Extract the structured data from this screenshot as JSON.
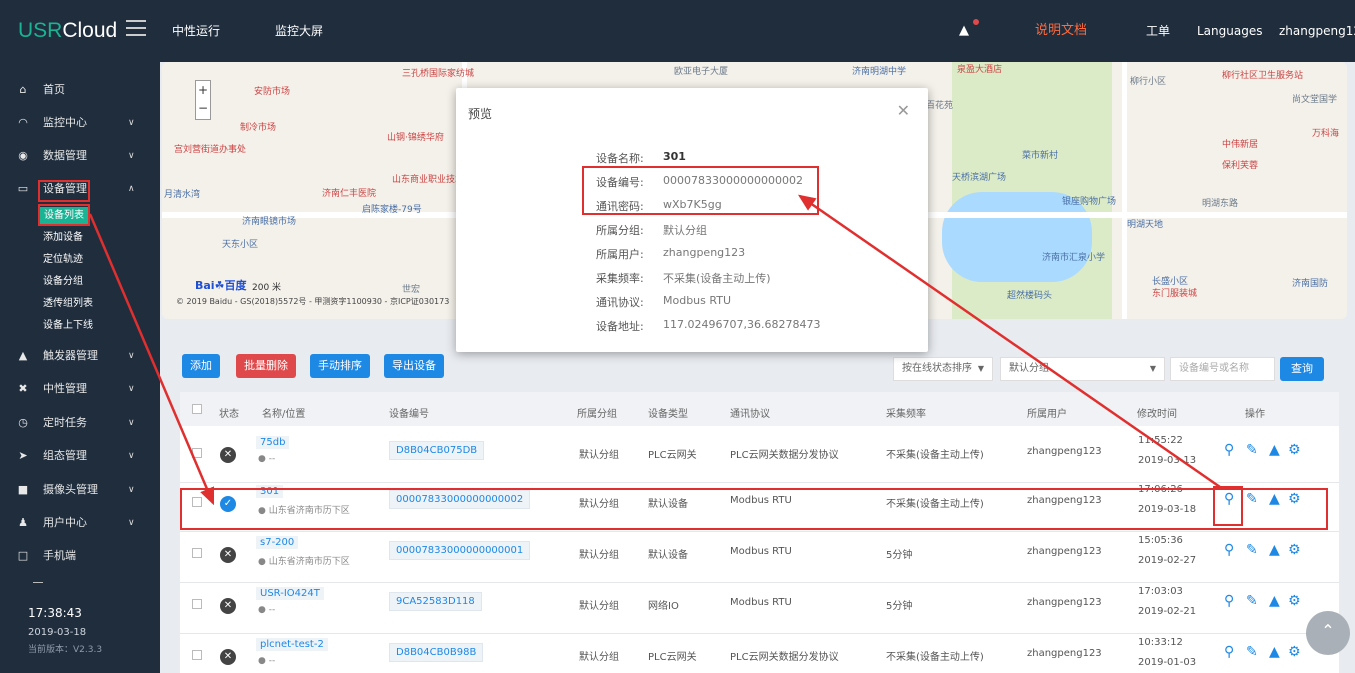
{
  "topbar": {
    "logo_brand": "USR",
    "logo_rest": "Cloud",
    "nav": [
      "中性运行",
      "监控大屏"
    ],
    "docs": "说明文档",
    "ticket": "工单",
    "languages": "Languages",
    "user": "zhangpeng123"
  },
  "sidebar": {
    "items": [
      {
        "icon": "home-icon",
        "label": "首页"
      },
      {
        "icon": "monitor-icon",
        "label": "监控中心"
      },
      {
        "icon": "data-icon",
        "label": "数据管理"
      },
      {
        "icon": "device-icon",
        "label": "设备管理"
      },
      {
        "icon": "trigger-icon",
        "label": "触发器管理"
      },
      {
        "icon": "tools-icon",
        "label": "中性管理"
      },
      {
        "icon": "clock-icon",
        "label": "定时任务"
      },
      {
        "icon": "config-icon",
        "label": "组态管理"
      },
      {
        "icon": "camera-icon",
        "label": "摄像头管理"
      },
      {
        "icon": "users-icon",
        "label": "用户中心"
      },
      {
        "icon": "mobile-icon",
        "label": "手机端"
      }
    ],
    "sub_items": [
      "设备列表",
      "添加设备",
      "定位轨迹",
      "设备分组",
      "透传组列表",
      "设备上下线"
    ],
    "time": "17:38:43",
    "date": "2019-03-18",
    "version": "当前版本：V2.3.3"
  },
  "map": {
    "labels": [
      "安防市场",
      "制冷市场",
      "山钢·锦绣华府",
      "山东商业职业技术学院",
      "济南仁丰医院",
      "启陈家楼-79号",
      "济南眼镜市场",
      "天东小区",
      "世宏",
      "三孔桥国际家纺城",
      "欧亚电子大厦",
      "济南明湖中学",
      "泉盈大酒店",
      "柳行小区",
      "柳行社区卫生服务站",
      "尚文堂国学",
      "万科海",
      "菜市新村",
      "天桥滨湖广场",
      "中伟新居",
      "保利芙蓉",
      "银座购物广场",
      "明湖天地",
      "明湖东路",
      "济南市汇泉小学",
      "长盛小区",
      "东门服装城",
      "济南国防",
      "超然楼码头",
      "百花苑",
      "宫刘营街道办事处",
      "月清水湾"
    ],
    "scale": "200 米",
    "copyright": "© 2019 Baidu - GS(2018)5572号 - 甲测资字1100930 - 京ICP证030173"
  },
  "modal": {
    "title": "预览",
    "fields": [
      {
        "k": "设备名称:",
        "v": "301"
      },
      {
        "k": "设备编号:",
        "v": "00007833000000000002"
      },
      {
        "k": "通讯密码:",
        "v": "wXb7K5gg"
      },
      {
        "k": "所属分组:",
        "v": "默认分组"
      },
      {
        "k": "所属用户:",
        "v": "zhangpeng123"
      },
      {
        "k": "采集频率:",
        "v": "不采集(设备主动上传)"
      },
      {
        "k": "通讯协议:",
        "v": "Modbus RTU"
      },
      {
        "k": "设备地址:",
        "v": "117.02496707,36.68278473"
      }
    ]
  },
  "toolbar": {
    "add": "添加",
    "batch_delete": "批量删除",
    "manual_sort": "手动排序",
    "export": "导出设备",
    "sort_select": "按在线状态排序",
    "group_select": "默认分组",
    "search_placeholder": "设备编号或名称",
    "query": "查询"
  },
  "table": {
    "headers": [
      "状态",
      "名称/位置",
      "设备编号",
      "所属分组",
      "设备类型",
      "通讯协议",
      "采集频率",
      "所属用户",
      "修改时间",
      "操作"
    ],
    "rows": [
      {
        "status": "offline",
        "name": "75db",
        "location": "--",
        "device_no": "D8B04CB075DB",
        "group": "默认分组",
        "type": "PLC云网关",
        "protocol": "PLC云网关数据分发协议",
        "freq": "不采集(设备主动上传)",
        "user": "zhangpeng123",
        "time": "11:55:22",
        "date": "2019-03-13"
      },
      {
        "status": "online",
        "name": "301",
        "location": "山东省济南市历下区",
        "device_no": "00007833000000000002",
        "group": "默认分组",
        "type": "默认设备",
        "protocol": "Modbus RTU",
        "freq": "不采集(设备主动上传)",
        "user": "zhangpeng123",
        "time": "17:06:26",
        "date": "2019-03-18"
      },
      {
        "status": "offline",
        "name": "s7-200",
        "location": "山东省济南市历下区",
        "device_no": "00007833000000000001",
        "group": "默认分组",
        "type": "默认设备",
        "protocol": "Modbus RTU",
        "freq": "5分钟",
        "user": "zhangpeng123",
        "time": "15:05:36",
        "date": "2019-02-27"
      },
      {
        "status": "offline",
        "name": "USR-IO424T",
        "location": "--",
        "device_no": "9CA52583D118",
        "group": "默认分组",
        "type": "网络IO",
        "protocol": "Modbus RTU",
        "freq": "5分钟",
        "user": "zhangpeng123",
        "time": "17:03:03",
        "date": "2019-02-21"
      },
      {
        "status": "offline",
        "name": "plcnet-test-2",
        "location": "--",
        "device_no": "D8B04CB0B98B",
        "group": "默认分组",
        "type": "PLC云网关",
        "protocol": "PLC云网关数据分发协议",
        "freq": "不采集(设备主动上传)",
        "user": "zhangpeng123",
        "time": "10:33:12",
        "date": "2019-01-03"
      }
    ]
  },
  "colors": {
    "sidebar": "#1f2d3d",
    "accent": "#1e88e5",
    "annotation": "#e02f2f",
    "danger": "#e0494b"
  }
}
